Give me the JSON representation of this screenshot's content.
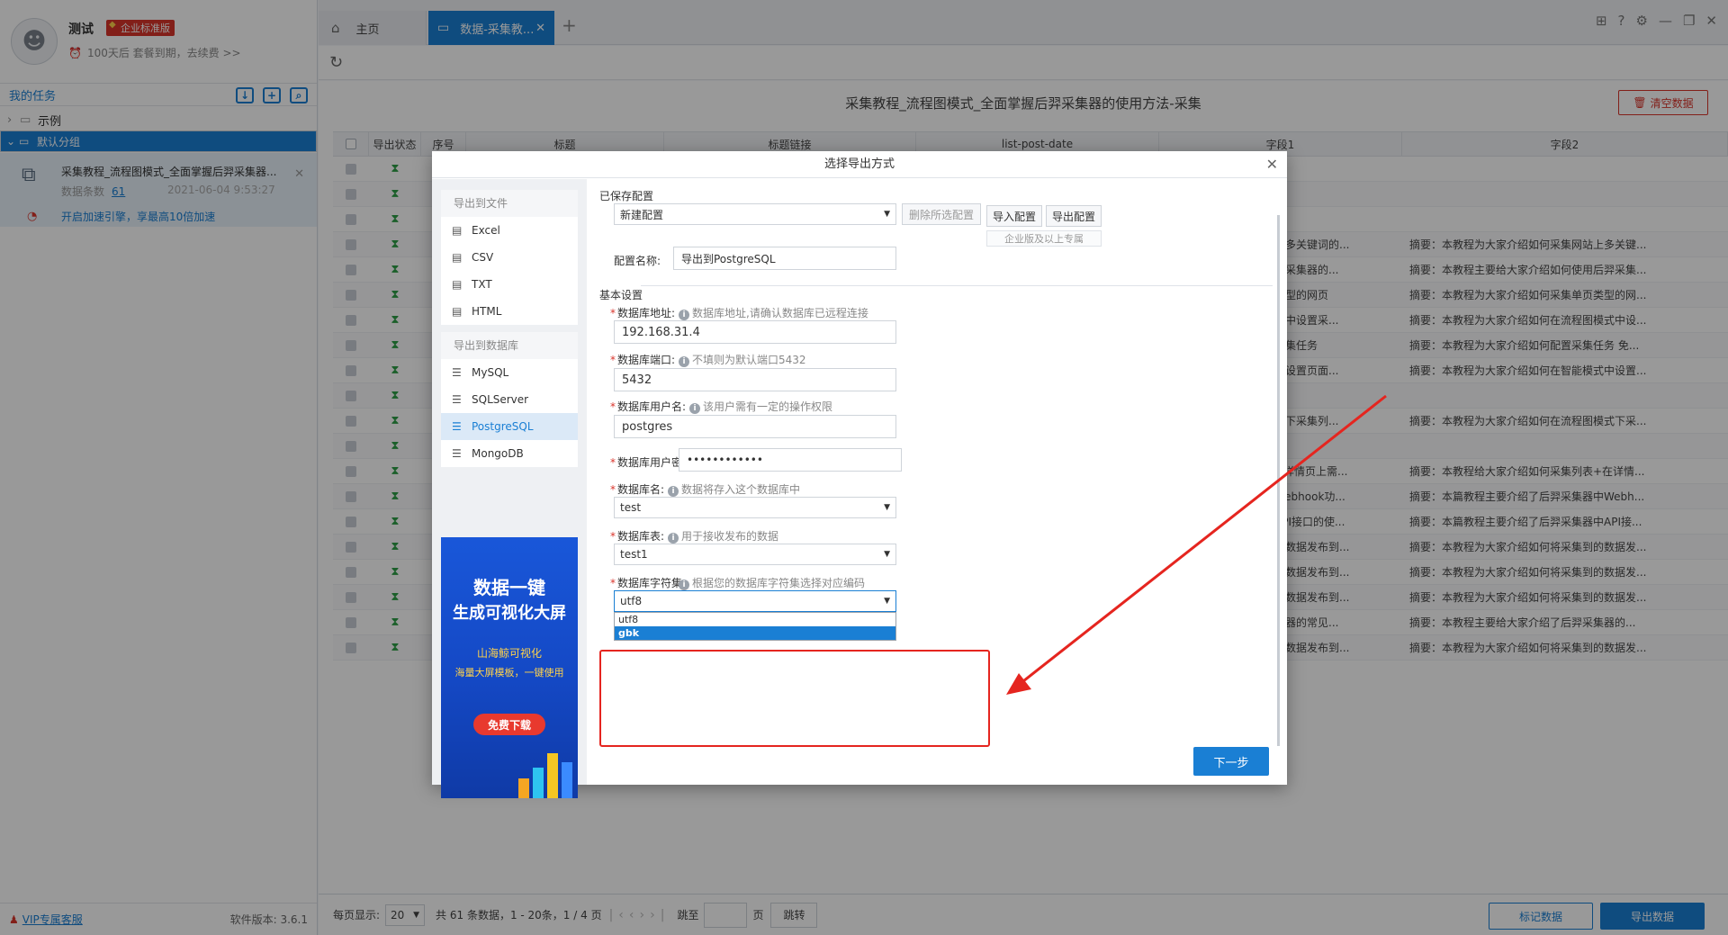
{
  "user": {
    "name": "测试",
    "edition": "企业标准版",
    "expire_note": "100天后 套餐到期，去续费 >>"
  },
  "sidebar": {
    "section_title": "我的任务",
    "groups": [
      {
        "label": "示例",
        "expanded": false
      },
      {
        "label": "默认分组",
        "expanded": true
      }
    ],
    "task": {
      "title": "采集教程_流程图模式_全面掌握后羿采集器...",
      "count_label": "数据条数",
      "count": "61",
      "date": "2021-06-04 9:53:27"
    },
    "speedup": "开启加速引擎，享最高10倍加速",
    "vip_link": "VIP专属客服",
    "version": "软件版本: 3.6.1"
  },
  "tabs": {
    "home": "主页",
    "active": "数据-采集教..."
  },
  "content": {
    "title": "采集教程_流程图模式_全面掌握后羿采集器的使用方法-采集",
    "clear_button": "清空数据",
    "columns": [
      "导出状态",
      "序号",
      "标题",
      "标题链接",
      "list-post-date",
      "字段1",
      "字段2"
    ],
    "rows": [
      {
        "f1": "",
        "f2": ""
      },
      {
        "f1": "",
        "f2": ""
      },
      {
        "f1": "",
        "f2": ""
      },
      {
        "f1": "大家介绍如何采集网站上多关键词的...",
        "f2": "摘要：本教程为大家介绍如何采集网站上多关键..."
      },
      {
        "f1": "给大家介绍如何使用后羿采集器的...",
        "f2": "摘要：本教程主要给大家介绍如何使用后羿采集..."
      },
      {
        "f1": "大家介绍如何采集单页类型的网页",
        "f2": "摘要：本教程为大家介绍如何采集单页类型的网..."
      },
      {
        "f1": "家介绍如何在流程图模式中设置采...",
        "f2": "摘要：本教程为大家介绍如何在流程图模式中设..."
      },
      {
        "f1": "程为大家介绍如何配置采集任务",
        "f2": "摘要：本教程为大家介绍如何配置采集任务 免..."
      },
      {
        "f1": "家介绍如何在智能模式中设置页面...",
        "f2": "摘要：本教程为大家介绍如何在智能模式中设置..."
      },
      {
        "f1": "",
        "f2": ""
      },
      {
        "f1": "家介绍如何在流程图模式下采集列...",
        "f2": "摘要：本教程为大家介绍如何在流程图模式下采..."
      },
      {
        "f1": "",
        "f2": ""
      },
      {
        "f1": "家介绍如何采集列表+在详情页上需...",
        "f2": "摘要：本教程给大家介绍如何采集列表+在详情..."
      },
      {
        "f1": "要介绍了后羿采集器中Webhook功...",
        "f2": "摘要：本篇教程主要介绍了后羿采集器中Webh..."
      },
      {
        "f1": "要介绍了后羿采集器中API接口的使...",
        "f2": "摘要：本篇教程主要介绍了后羿采集器中API接..."
      },
      {
        "f1": "大家介绍如何将采集到的数据发布到...",
        "f2": "摘要：本教程为大家介绍如何将采集到的数据发..."
      },
      {
        "f1": "大家介绍如何将采集到的数据发布到...",
        "f2": "摘要：本教程为大家介绍如何将采集到的数据发..."
      },
      {
        "f1": "大家介绍如何将采集到的数据发布到...",
        "f2": "摘要：本教程为大家介绍如何将采集到的数据发..."
      },
      {
        "f1": "要给大家介绍了后羿采集器的常见...",
        "f2": "摘要：本教程主要给大家介绍了后羿采集器的..."
      },
      {
        "f1": "大家介绍如何将采集到的数据发布到...",
        "f2": "摘要：本教程为大家介绍如何将采集到的数据发..."
      }
    ]
  },
  "pager": {
    "per_page_label": "每页显示:",
    "per_page": "20",
    "summary": "共 61 条数据，1 - 20条，1 / 4 页",
    "goto_label": "跳至",
    "page_unit": "页",
    "jump": "跳转",
    "mark_button": "标记数据",
    "export_button": "导出数据"
  },
  "modal": {
    "title": "选择导出方式",
    "file_group": "导出到文件",
    "file_options": [
      "Excel",
      "CSV",
      "TXT",
      "HTML"
    ],
    "db_group": "导出到数据库",
    "db_options": [
      "MySQL",
      "SQLServer",
      "PostgreSQL",
      "MongoDB"
    ],
    "selected_db": "PostgreSQL",
    "ad": {
      "line1": "数据一键",
      "line2": "生成可视化大屏",
      "line3": "山海鲸可视化",
      "line4": "海量大屏模板，一键使用",
      "button": "免费下载"
    },
    "saved_config_label": "已保存配置",
    "config_select": "新建配置",
    "delete_config": "删除所选配置",
    "import_config": "导入配置",
    "export_config": "导出配置",
    "enterprise_note": "企业版及以上专属",
    "config_name_label": "配置名称:",
    "config_name": "导出到PostgreSQL",
    "basic_settings": "基本设置",
    "fields": {
      "host": {
        "label": "数据库地址:",
        "hint": "数据库地址,请确认数据库已远程连接",
        "value": "192.168.31.4"
      },
      "port": {
        "label": "数据库端口:",
        "hint": "不填则为默认端口5432",
        "value": "5432"
      },
      "user": {
        "label": "数据库用户名:",
        "hint": "该用户需有一定的操作权限",
        "value": "postgres"
      },
      "password": {
        "label": "数据库用户密码:",
        "value": "••••••••••••"
      },
      "dbname": {
        "label": "数据库名:",
        "hint": "数据将存入这个数据库中",
        "value": "test"
      },
      "table": {
        "label": "数据库表:",
        "hint": "用于接收发布的数据",
        "value": "test1"
      },
      "charset": {
        "label": "数据库字符集:",
        "hint": "根据您的数据库字符集选择对应编码",
        "value": "utf8",
        "options": [
          "utf8",
          "gbk"
        ],
        "highlighted": "gbk"
      }
    },
    "next_button": "下一步"
  },
  "colors": {
    "accent": "#1a7fd4",
    "danger": "#d9342b",
    "annotation": "#e5251f"
  }
}
